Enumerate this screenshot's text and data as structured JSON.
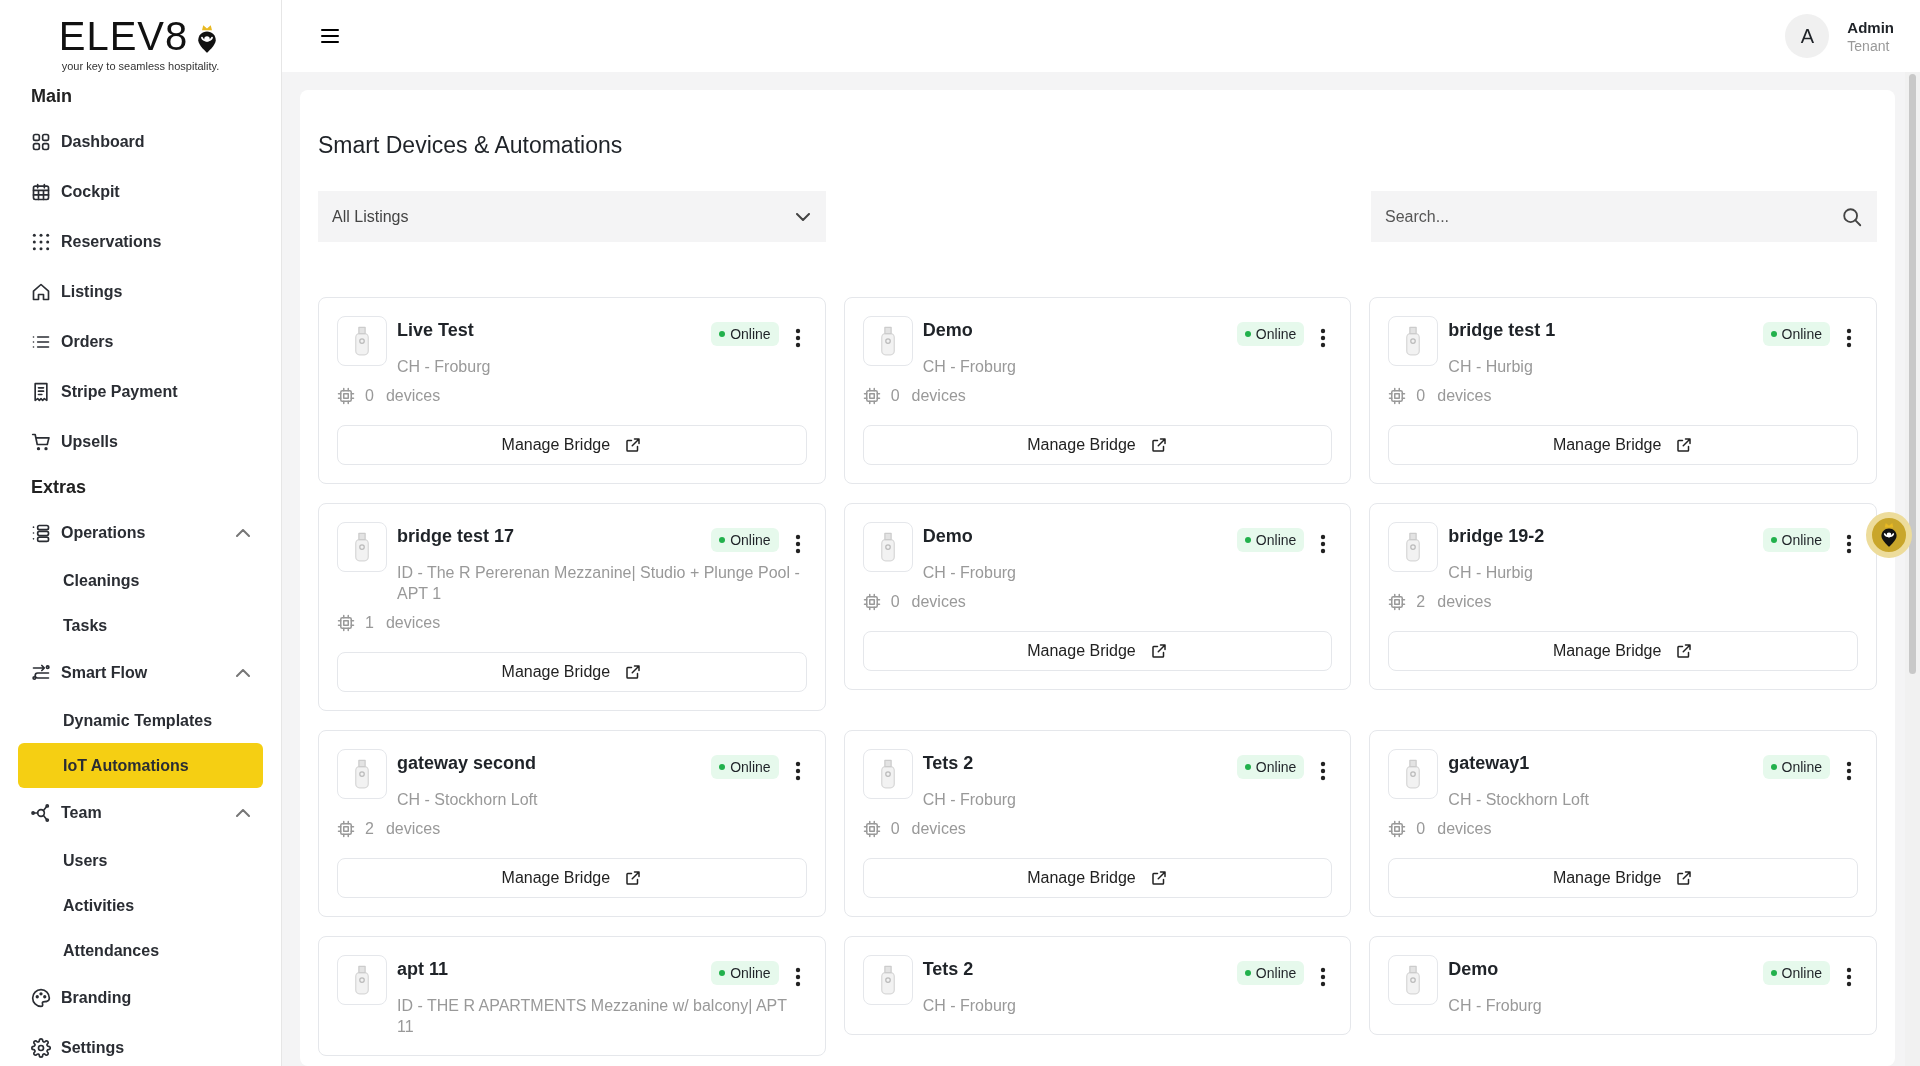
{
  "brand": {
    "name": "ELEV8",
    "tagline": "your key to seamless hospitality."
  },
  "sidebar": {
    "sections": [
      {
        "heading": "Main",
        "items": [
          {
            "label": "Dashboard",
            "selected": false
          },
          {
            "label": "Cockpit",
            "selected": false
          },
          {
            "label": "Reservations",
            "selected": false
          },
          {
            "label": "Listings",
            "selected": false
          },
          {
            "label": "Orders",
            "selected": false
          },
          {
            "label": "Stripe Payment",
            "selected": false
          },
          {
            "label": "Upsells",
            "selected": false
          }
        ]
      },
      {
        "heading": "Extras",
        "items": [
          {
            "label": "Operations",
            "selected": false,
            "expanded": true,
            "children": [
              {
                "label": "Cleanings",
                "selected": false
              },
              {
                "label": "Tasks",
                "selected": false
              }
            ]
          },
          {
            "label": "Smart Flow",
            "selected": false,
            "expanded": true,
            "children": [
              {
                "label": "Dynamic Templates",
                "selected": false
              },
              {
                "label": "IoT Automations",
                "selected": true
              }
            ]
          },
          {
            "label": "Team",
            "selected": false,
            "expanded": true,
            "children": [
              {
                "label": "Users",
                "selected": false
              },
              {
                "label": "Activities",
                "selected": false
              },
              {
                "label": "Attendances",
                "selected": false
              }
            ]
          },
          {
            "label": "Branding",
            "selected": false
          },
          {
            "label": "Settings",
            "selected": false
          }
        ]
      }
    ]
  },
  "user": {
    "initial": "A",
    "name": "Admin",
    "role": "Tenant"
  },
  "page": {
    "title": "Smart Devices & Automations",
    "listing_filter": {
      "value": "All Listings"
    },
    "search": {
      "placeholder": "Search..."
    }
  },
  "bridges": [
    {
      "name": "Live Test",
      "location": "CH - Froburg",
      "status": "Online",
      "device_count": "0",
      "devices_label": "devices",
      "button": "Manage Bridge"
    },
    {
      "name": "Demo",
      "location": "CH - Froburg",
      "status": "Online",
      "device_count": "0",
      "devices_label": "devices",
      "button": "Manage Bridge"
    },
    {
      "name": "bridge test 1",
      "location": "CH - Hurbig",
      "status": "Online",
      "device_count": "0",
      "devices_label": "devices",
      "button": "Manage Bridge"
    },
    {
      "name": "bridge test 17",
      "location": "ID - The R Pererenan Mezzanine| Studio + Plunge Pool - APT 1",
      "status": "Online",
      "device_count": "1",
      "devices_label": "devices",
      "button": "Manage Bridge"
    },
    {
      "name": "Demo",
      "location": "CH - Froburg",
      "status": "Online",
      "device_count": "0",
      "devices_label": "devices",
      "button": "Manage Bridge"
    },
    {
      "name": "bridge 19-2",
      "location": "CH - Hurbig",
      "status": "Online",
      "device_count": "2",
      "devices_label": "devices",
      "button": "Manage Bridge"
    },
    {
      "name": "gateway second",
      "location": "CH - Stockhorn Loft",
      "status": "Online",
      "device_count": "2",
      "devices_label": "devices",
      "button": "Manage Bridge"
    },
    {
      "name": "Tets 2",
      "location": "CH - Froburg",
      "status": "Online",
      "device_count": "0",
      "devices_label": "devices",
      "button": "Manage Bridge"
    },
    {
      "name": "gateway1",
      "location": "CH - Stockhorn Loft",
      "status": "Online",
      "device_count": "0",
      "devices_label": "devices",
      "button": "Manage Bridge"
    },
    {
      "name": "apt 11",
      "location": "ID - THE R APARTMENTS Mezzanine w/ balcony| APT 11",
      "status": "Online"
    },
    {
      "name": "Tets 2",
      "location": "CH - Froburg",
      "status": "Online"
    },
    {
      "name": "Demo",
      "location": "CH - Froburg",
      "status": "Online"
    }
  ]
}
